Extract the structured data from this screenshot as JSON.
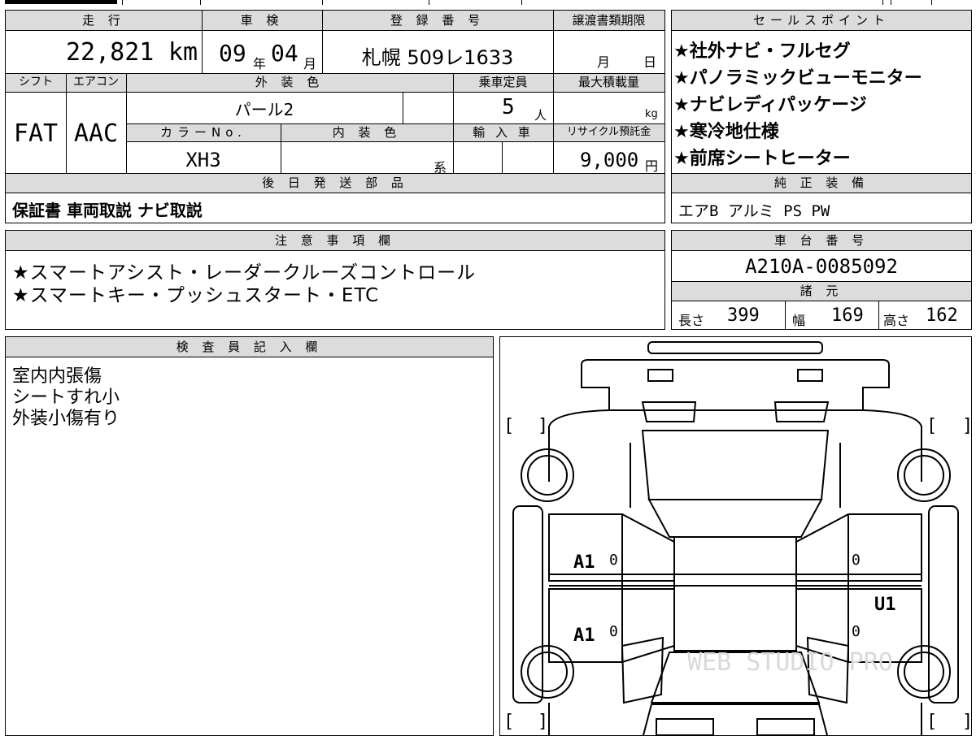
{
  "vehicle": {
    "mileage_label": "走 行",
    "mileage_value": "22,821",
    "mileage_unit": "km",
    "inspection_label": "車 検",
    "inspection_year": "09",
    "inspection_year_unit": "年",
    "inspection_month": "04",
    "inspection_month_unit": "月",
    "registration_label": "登 録 番 号",
    "registration_value": "札幌 509レ1633",
    "transfer_label": "譲渡書類期限",
    "transfer_month_unit": "月",
    "transfer_day_unit": "日",
    "shift_label": "シフト",
    "shift_value": "FAT",
    "aircon_label": "エアコン",
    "aircon_value": "AAC",
    "exterior_label": "外 装 色",
    "exterior_value": "パール2",
    "capacity_label": "乗車定員",
    "capacity_value": "5",
    "capacity_unit": "人",
    "load_label": "最大積載量",
    "load_unit": "kg",
    "colorno_label": "カラーNo.",
    "colorno_value": "XH3",
    "interior_label": "内 装 色",
    "interior_unit": "系",
    "import_label": "輸 入 車",
    "recycle_label": "リサイクル預託金",
    "recycle_value": "9,000",
    "recycle_unit": "円"
  },
  "sales_points": {
    "header": "セールスポイント",
    "items": [
      "★社外ナビ・フルセグ",
      "★パノラミックビューモニター",
      "★ナビレディパッケージ",
      "★寒冷地仕様",
      "★前席シートヒーター"
    ]
  },
  "later_parts": {
    "header": "後 日 発 送 部 品",
    "value": "保証書 車両取説 ナビ取説"
  },
  "factory_equipment": {
    "header": "純 正 装 備",
    "value": "エアB アルミ PS PW"
  },
  "notes": {
    "header": "注 意 事 項 欄",
    "lines": [
      "★スマートアシスト・レーダークルーズコントロール",
      "★スマートキー・プッシュスタート・ETC"
    ]
  },
  "chassis": {
    "header": "車 台 番 号",
    "value": "A210A-0085092"
  },
  "specs": {
    "header": "諸 元",
    "length_label": "長さ",
    "length_value": "399",
    "width_label": "幅",
    "width_value": "169",
    "height_label": "高さ",
    "height_value": "162"
  },
  "inspector": {
    "header": "検 査 員 記 入 欄",
    "lines": [
      "室内内張傷",
      "シートすれ小",
      "外装小傷有り"
    ]
  },
  "diagram": {
    "marks": {
      "left_front_door": "A1",
      "left_rear_door": "A1",
      "right_rear_door": "U1"
    },
    "zeros": [
      "0",
      "0",
      "0",
      "0"
    ],
    "bracket_left": "[",
    "bracket_right": "]",
    "watermark": "WEB STUDIO PRO"
  }
}
